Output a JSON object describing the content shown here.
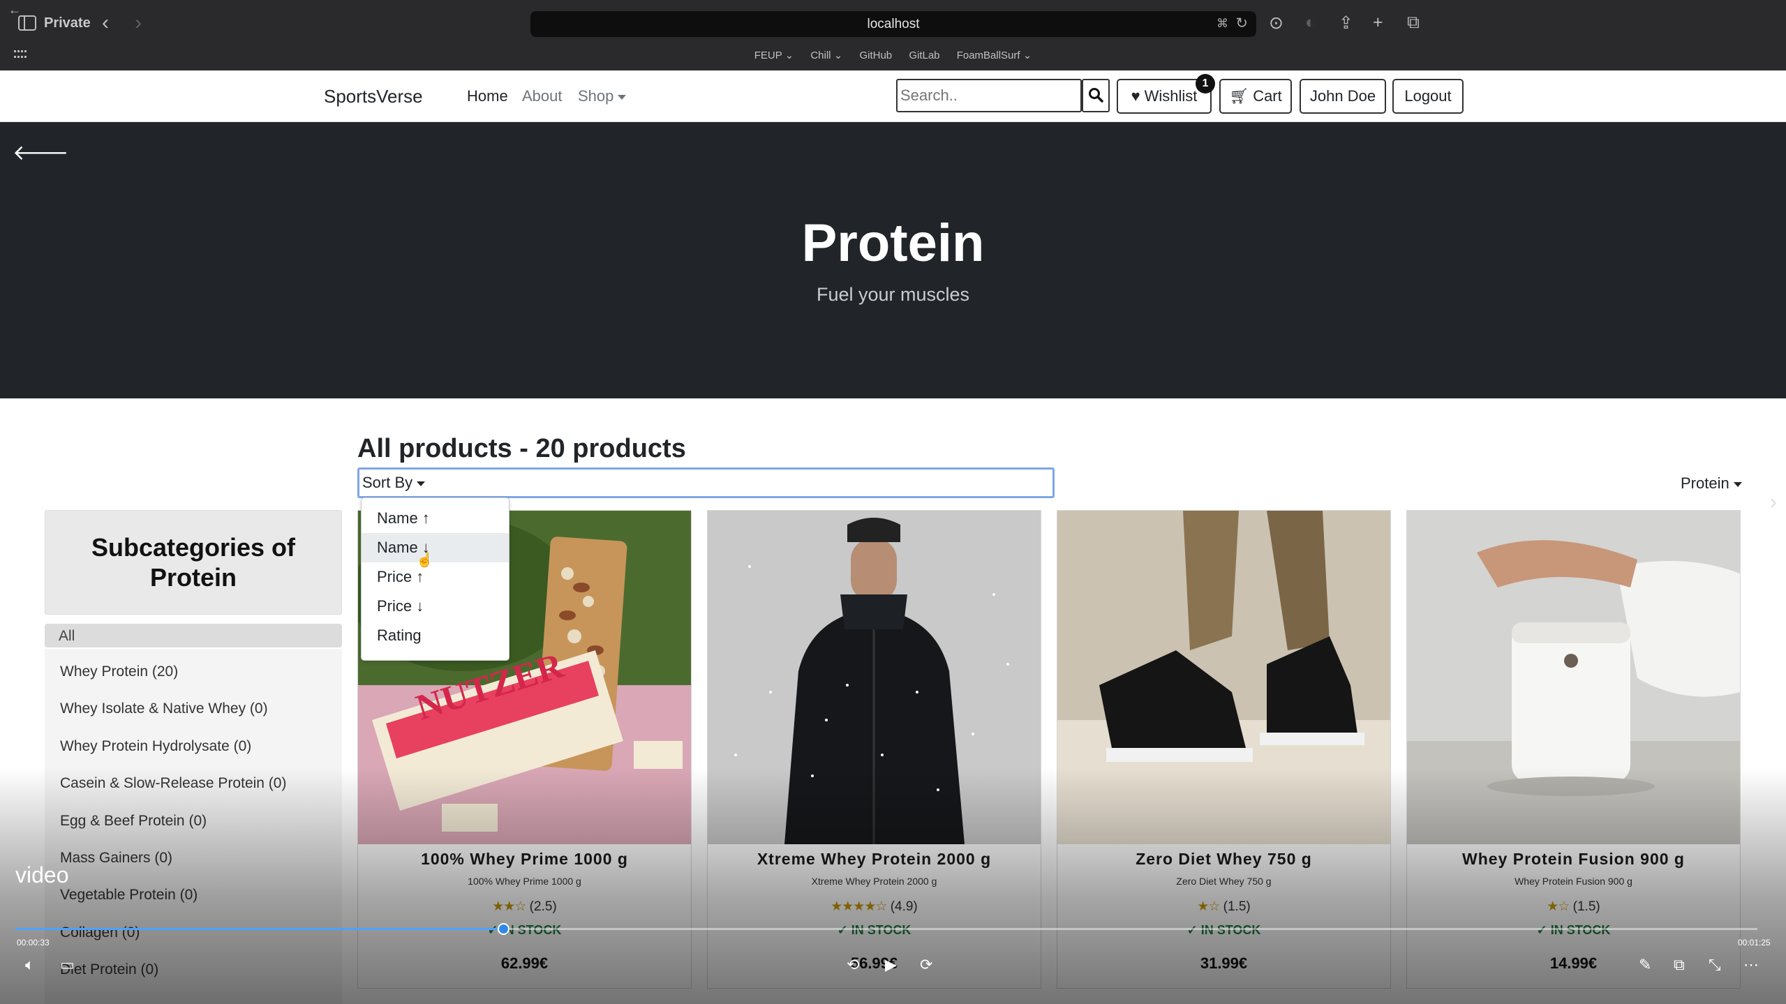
{
  "browser": {
    "private_label": "Private",
    "url": "localhost",
    "bookmarks": [
      "FEUP",
      "Chill",
      "GitHub",
      "GitLab",
      "FoamBallSurf"
    ]
  },
  "navbar": {
    "brand": "SportsVerse",
    "links": [
      "Home",
      "About",
      "Shop"
    ],
    "search_placeholder": "Search..",
    "wishlist_label": "Wishlist",
    "wishlist_count": "1",
    "cart_label": "Cart",
    "user_label": "John Doe",
    "logout_label": "Logout"
  },
  "hero": {
    "title": "Protein",
    "subtitle": "Fuel your muscles"
  },
  "sidebar": {
    "title": "Subcategories of Protein",
    "items": [
      "All",
      "Whey Protein (20)",
      "Whey Isolate & Native Whey (0)",
      "Whey Protein Hydrolysate (0)",
      "Casein & Slow-Release Protein (0)",
      "Egg & Beef Protein (0)",
      "Mass Gainers (0)",
      "Vegetable Protein (0)",
      "Collagen (0)",
      "Diet Protein (0)"
    ]
  },
  "products": {
    "heading": "All products - 20 products",
    "sort_label": "Sort By",
    "category_dropdown": "Protein",
    "sort_options": [
      "Name ↑",
      "Name ↓",
      "Price ↑",
      "Price ↓",
      "Rating"
    ],
    "cards": [
      {
        "name": "100% Whey Prime 1000 g",
        "subname": "100% Whey Prime 1000 g",
        "stars": "★★☆",
        "rating": "(2.5)",
        "stock": "✓ IN STOCK",
        "price": "62.99€"
      },
      {
        "name": "Xtreme Whey Protein 2000 g",
        "subname": "Xtreme Whey Protein 2000 g",
        "stars": "★★★★☆",
        "rating": "(4.9)",
        "stock": "✓ IN STOCK",
        "price": "56.99€"
      },
      {
        "name": "Zero Diet Whey 750 g",
        "subname": "Zero Diet Whey 750 g",
        "stars": "★☆",
        "rating": "(1.5)",
        "stock": "✓ IN STOCK",
        "price": "31.99€"
      },
      {
        "name": "Whey Protein Fusion 900 g",
        "subname": "Whey Protein Fusion 900 g",
        "stars": "★☆",
        "rating": "(1.5)",
        "stock": "✓ IN STOCK",
        "price": "14.99€"
      }
    ]
  },
  "video": {
    "label": "video",
    "time_current": "00:00:33",
    "time_total": "00:01:25",
    "progress": 0.28
  },
  "colors": {
    "hero_bg": "#212529",
    "accent": "#7ea6e8",
    "stock": "#1f7a3e",
    "star": "#c8960a"
  }
}
